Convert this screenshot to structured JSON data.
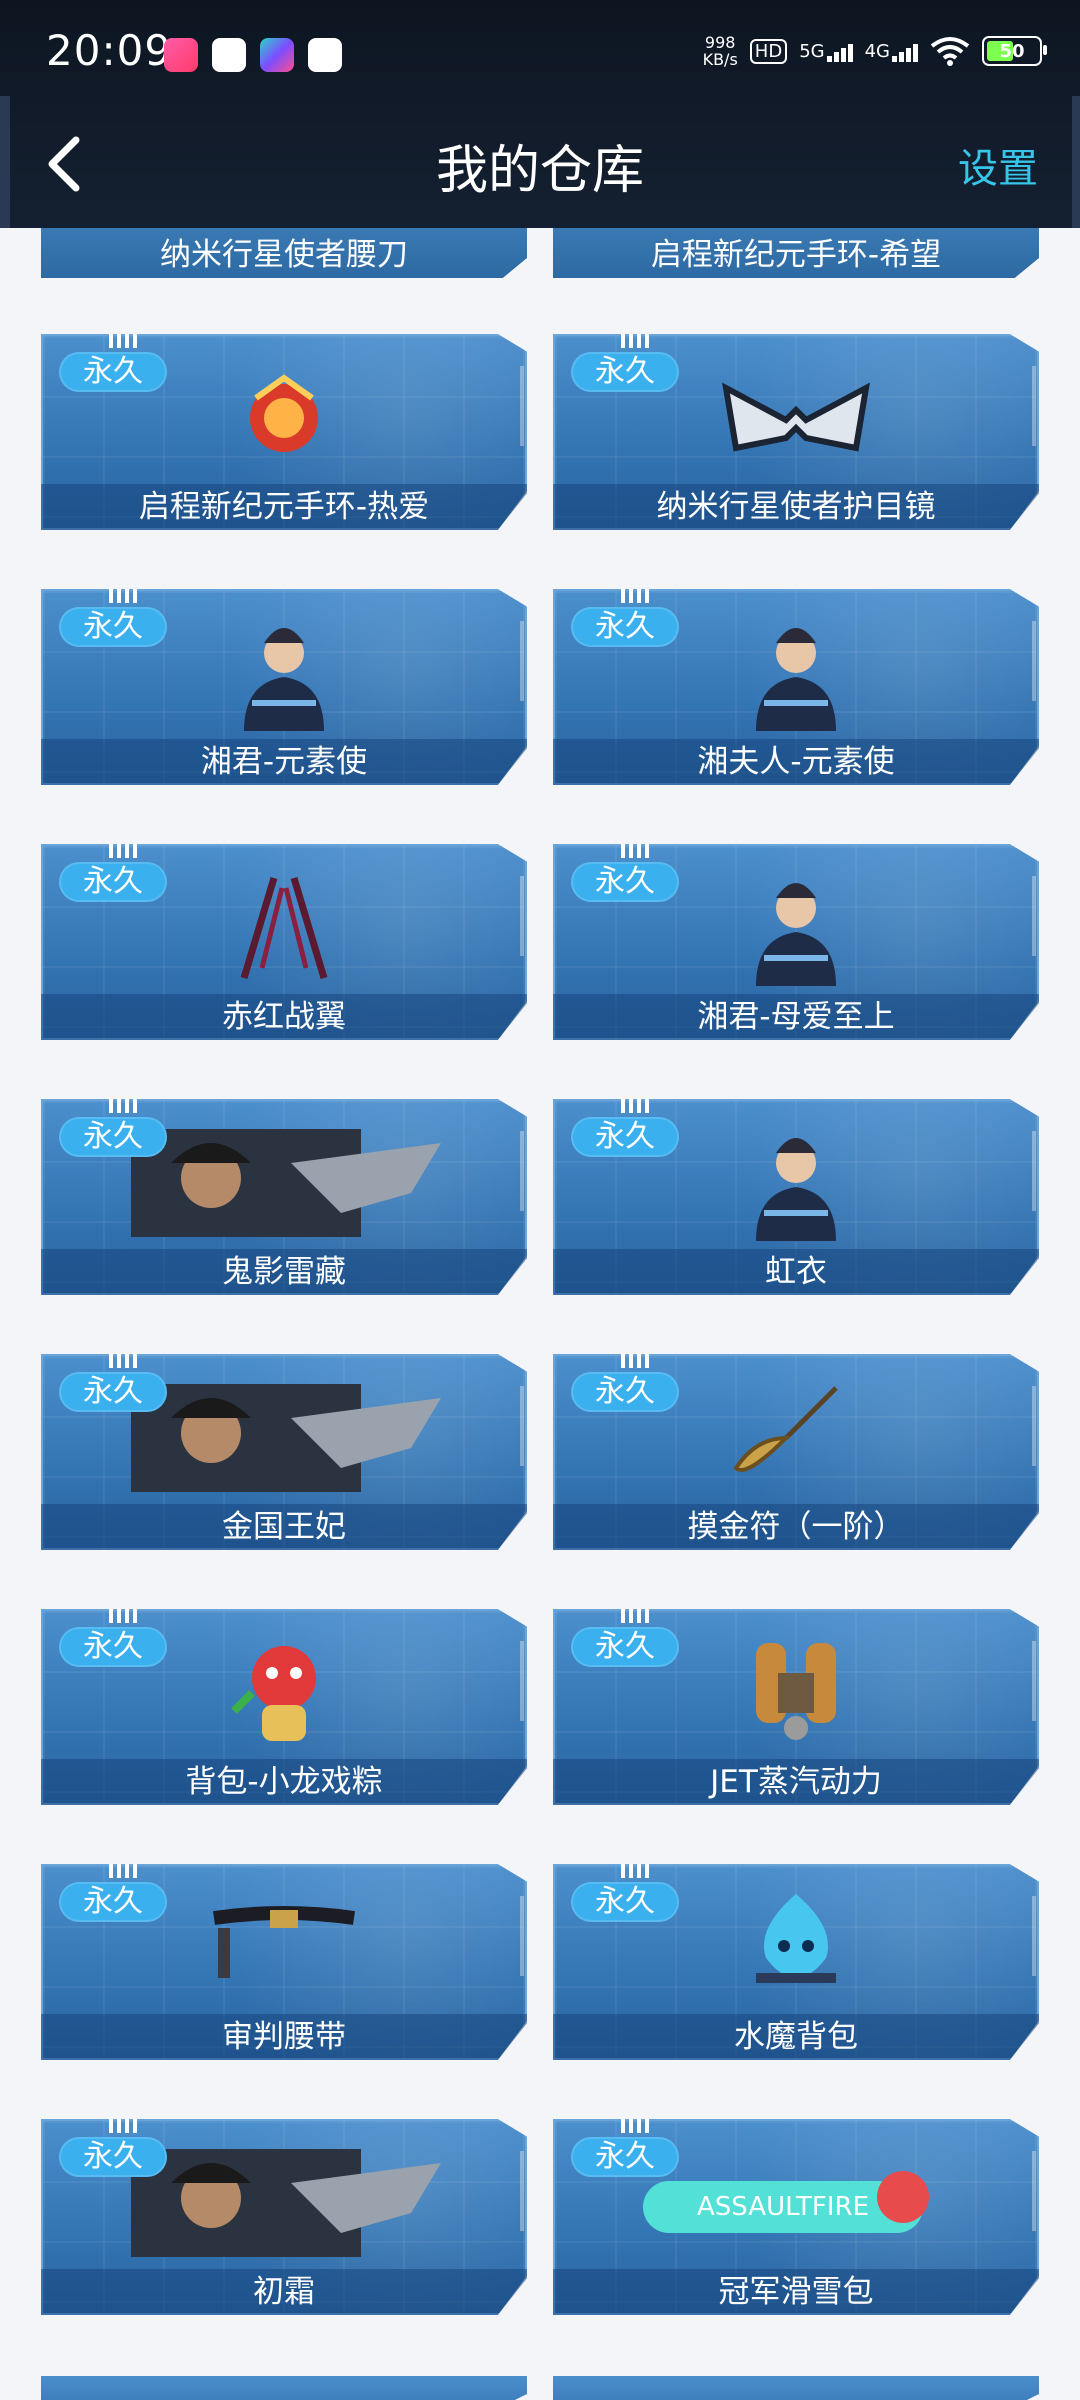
{
  "status_bar": {
    "time": "20:09",
    "net_speed": "998",
    "net_unit": "KB/s",
    "hd": "HD",
    "sim1": "5G",
    "sim2": "4G",
    "battery": "50"
  },
  "header": {
    "title": "我的仓库",
    "settings_label": "设置"
  },
  "partial_top": [
    "纳米行星使者腰刀",
    "启程新纪元手环-希望"
  ],
  "items": [
    {
      "badge": "永久",
      "name": "启程新纪元手环-热爱",
      "icon": "bracelet-icon"
    },
    {
      "badge": "永久",
      "name": "纳米行星使者护目镜",
      "icon": "goggles-icon"
    },
    {
      "badge": "永久",
      "name": "湘君-元素使",
      "icon": "character-icon"
    },
    {
      "badge": "永久",
      "name": "湘夫人-元素使",
      "icon": "character-icon"
    },
    {
      "badge": "永久",
      "name": "赤红战翼",
      "icon": "wings-icon"
    },
    {
      "badge": "永久",
      "name": "湘君-母爱至上",
      "icon": "character-icon"
    },
    {
      "badge": "永久",
      "name": "鬼影雷藏",
      "icon": "character-card-icon"
    },
    {
      "badge": "永久",
      "name": "虹衣",
      "icon": "character-icon"
    },
    {
      "badge": "永久",
      "name": "金国王妃",
      "icon": "character-card-icon"
    },
    {
      "badge": "永久",
      "name": "摸金符（一阶）",
      "icon": "amulet-icon"
    },
    {
      "badge": "永久",
      "name": "背包-小龙戏粽",
      "icon": "dragon-backpack-icon"
    },
    {
      "badge": "永久",
      "name": "JET蒸汽动力",
      "icon": "jetpack-icon"
    },
    {
      "badge": "永久",
      "name": "审判腰带",
      "icon": "belt-icon"
    },
    {
      "badge": "永久",
      "name": "水魔背包",
      "icon": "water-demon-icon"
    },
    {
      "badge": "永久",
      "name": "初霜",
      "icon": "character-card-icon"
    },
    {
      "badge": "永久",
      "name": "冠军滑雪包",
      "icon": "ski-bag-icon"
    }
  ]
}
